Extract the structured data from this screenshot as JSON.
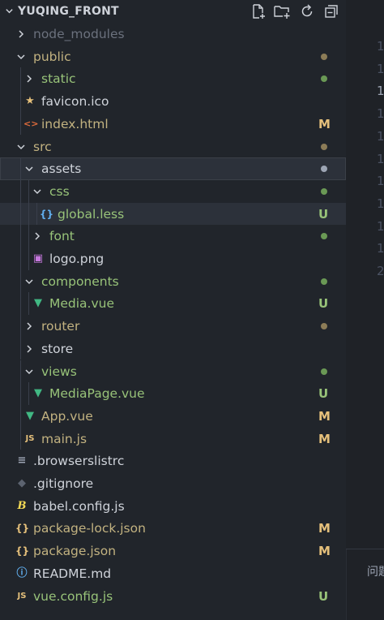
{
  "explorer": {
    "title": "YUQING_FRONT",
    "actions": [
      {
        "name": "new-file-icon"
      },
      {
        "name": "new-folder-icon"
      },
      {
        "name": "refresh-icon"
      },
      {
        "name": "collapse-all-icon"
      }
    ]
  },
  "colors": {
    "green": "#98c379",
    "olive": "#c2b280",
    "gray": "#9da5b4",
    "dim": "#6b717d",
    "modified": "#e5c07b",
    "untracked": "#98c379"
  },
  "tree": [
    {
      "label": "node_modules",
      "depth": 0,
      "type": "folder",
      "open": false,
      "color": "dim",
      "status": "",
      "dot": ""
    },
    {
      "label": "public",
      "depth": 0,
      "type": "folder",
      "open": true,
      "color": "olive",
      "status": "",
      "dot": "olive"
    },
    {
      "label": "static",
      "depth": 1,
      "type": "folder",
      "open": false,
      "color": "green",
      "status": "",
      "dot": "green"
    },
    {
      "label": "favicon.ico",
      "depth": 1,
      "type": "star",
      "color": "text",
      "status": "",
      "dot": ""
    },
    {
      "label": "index.html",
      "depth": 1,
      "type": "html",
      "color": "olive",
      "status": "M",
      "dot": ""
    },
    {
      "label": "src",
      "depth": 0,
      "type": "folder",
      "open": true,
      "color": "olive",
      "status": "",
      "dot": "olive"
    },
    {
      "label": "assets",
      "depth": 1,
      "type": "folder",
      "open": true,
      "color": "text",
      "status": "",
      "dot": "gray",
      "state": "selected"
    },
    {
      "label": "css",
      "depth": 2,
      "type": "folder",
      "open": true,
      "color": "green",
      "status": "",
      "dot": "green"
    },
    {
      "label": "global.less",
      "depth": 3,
      "type": "braces",
      "color": "green",
      "status": "U",
      "dot": "",
      "state": "hover"
    },
    {
      "label": "font",
      "depth": 2,
      "type": "folder",
      "open": false,
      "color": "green",
      "status": "",
      "dot": "green"
    },
    {
      "label": "logo.png",
      "depth": 2,
      "type": "image",
      "color": "text",
      "status": "",
      "dot": ""
    },
    {
      "label": "components",
      "depth": 1,
      "type": "folder",
      "open": true,
      "color": "green",
      "status": "",
      "dot": "green"
    },
    {
      "label": "Media.vue",
      "depth": 2,
      "type": "vue",
      "color": "green",
      "status": "U",
      "dot": ""
    },
    {
      "label": "router",
      "depth": 1,
      "type": "folder",
      "open": false,
      "color": "olive",
      "status": "",
      "dot": "olive"
    },
    {
      "label": "store",
      "depth": 1,
      "type": "folder",
      "open": false,
      "color": "text",
      "status": "",
      "dot": ""
    },
    {
      "label": "views",
      "depth": 1,
      "type": "folder",
      "open": true,
      "color": "green",
      "status": "",
      "dot": "green"
    },
    {
      "label": "MediaPage.vue",
      "depth": 2,
      "type": "vue",
      "color": "green",
      "status": "U",
      "dot": ""
    },
    {
      "label": "App.vue",
      "depth": 1,
      "type": "vue",
      "color": "olive",
      "status": "M",
      "dot": ""
    },
    {
      "label": "main.js",
      "depth": 1,
      "type": "js",
      "color": "olive",
      "status": "M",
      "dot": ""
    },
    {
      "label": ".browserslistrc",
      "depth": 0,
      "type": "lines",
      "color": "text",
      "status": "",
      "dot": ""
    },
    {
      "label": ".gitignore",
      "depth": 0,
      "type": "git",
      "color": "text",
      "status": "",
      "dot": ""
    },
    {
      "label": "babel.config.js",
      "depth": 0,
      "type": "babel",
      "color": "text",
      "status": "",
      "dot": ""
    },
    {
      "label": "package-lock.json",
      "depth": 0,
      "type": "braces",
      "color": "olive",
      "status": "M",
      "dot": ""
    },
    {
      "label": "package.json",
      "depth": 0,
      "type": "braces",
      "color": "olive",
      "status": "M",
      "dot": ""
    },
    {
      "label": "README.md",
      "depth": 0,
      "type": "info",
      "color": "text",
      "status": "",
      "dot": ""
    },
    {
      "label": "vue.config.js",
      "depth": 0,
      "type": "js",
      "color": "green",
      "status": "U",
      "dot": ""
    }
  ],
  "gutter": {
    "line_numbers": [
      "1",
      "1",
      "1",
      "1",
      "1",
      "1",
      "1",
      "1",
      "1",
      "1",
      "2"
    ]
  },
  "panel": {
    "tab_label": "问题"
  }
}
